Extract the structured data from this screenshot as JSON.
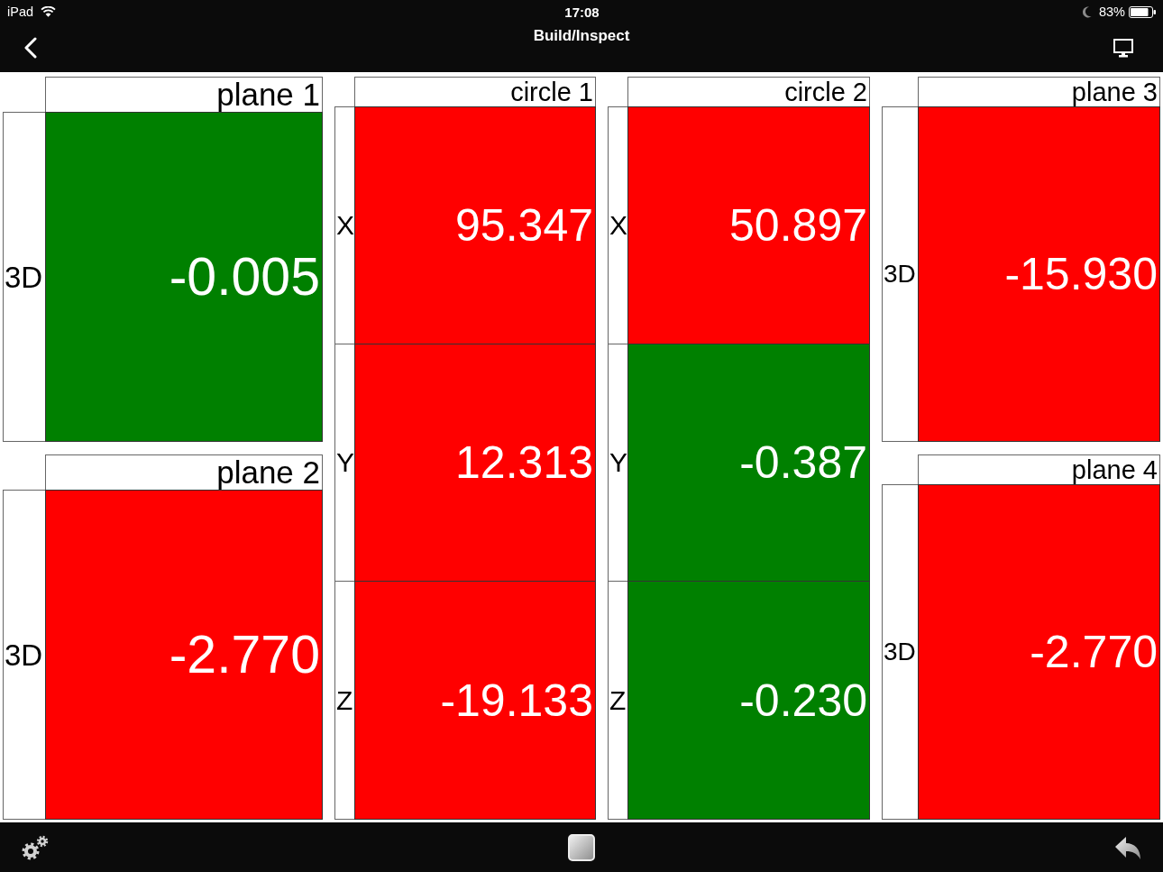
{
  "status_bar": {
    "device": "iPad",
    "time": "17:08",
    "battery": "83%"
  },
  "nav_bar": {
    "title": "Build/Inspect"
  },
  "columns": [
    {
      "features": [
        {
          "name": "plane 1",
          "measurements": [
            {
              "axis": "3D",
              "value": "-0.005",
              "color": "#008000"
            }
          ]
        },
        {
          "name": "plane 2",
          "measurements": [
            {
              "axis": "3D",
              "value": "-2.770",
              "color": "#ff0000"
            }
          ]
        }
      ]
    },
    {
      "features": [
        {
          "name": "circle 1",
          "measurements": [
            {
              "axis": "X",
              "value": "95.347",
              "color": "#ff0000"
            },
            {
              "axis": "Y",
              "value": "12.313",
              "color": "#ff0000"
            },
            {
              "axis": "Z",
              "value": "-19.133",
              "color": "#ff0000"
            }
          ]
        }
      ]
    },
    {
      "features": [
        {
          "name": "circle 2",
          "measurements": [
            {
              "axis": "X",
              "value": "50.897",
              "color": "#ff0000"
            },
            {
              "axis": "Y",
              "value": "-0.387",
              "color": "#008000"
            },
            {
              "axis": "Z",
              "value": "-0.230",
              "color": "#008000"
            }
          ]
        }
      ]
    },
    {
      "features": [
        {
          "name": "plane 3",
          "measurements": [
            {
              "axis": "3D",
              "value": "-15.930",
              "color": "#ff0000"
            }
          ]
        },
        {
          "name": "plane 4",
          "measurements": [
            {
              "axis": "3D",
              "value": "-2.770",
              "color": "#ff0000"
            }
          ]
        }
      ]
    }
  ]
}
